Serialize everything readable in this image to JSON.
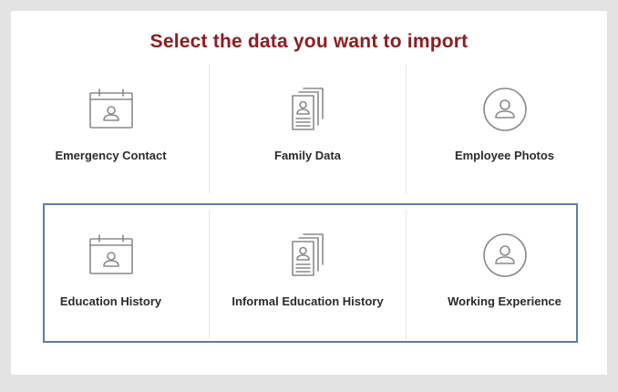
{
  "title": "Select the data you want to import",
  "items": [
    {
      "label": "Emergency Contact",
      "icon": "calendar-person-icon"
    },
    {
      "label": "Family Data",
      "icon": "document-stack-icon"
    },
    {
      "label": "Employee Photos",
      "icon": "user-circle-icon"
    },
    {
      "label": "Education History",
      "icon": "calendar-person-icon"
    },
    {
      "label": "Informal Education History",
      "icon": "document-stack-icon"
    },
    {
      "label": "Working Experience",
      "icon": "user-circle-icon"
    }
  ],
  "colors": {
    "title": "#8b1e22",
    "selection_border": "#5b7ea5",
    "icon_stroke": "#8a8a8a",
    "background": "#e3e3e3"
  }
}
